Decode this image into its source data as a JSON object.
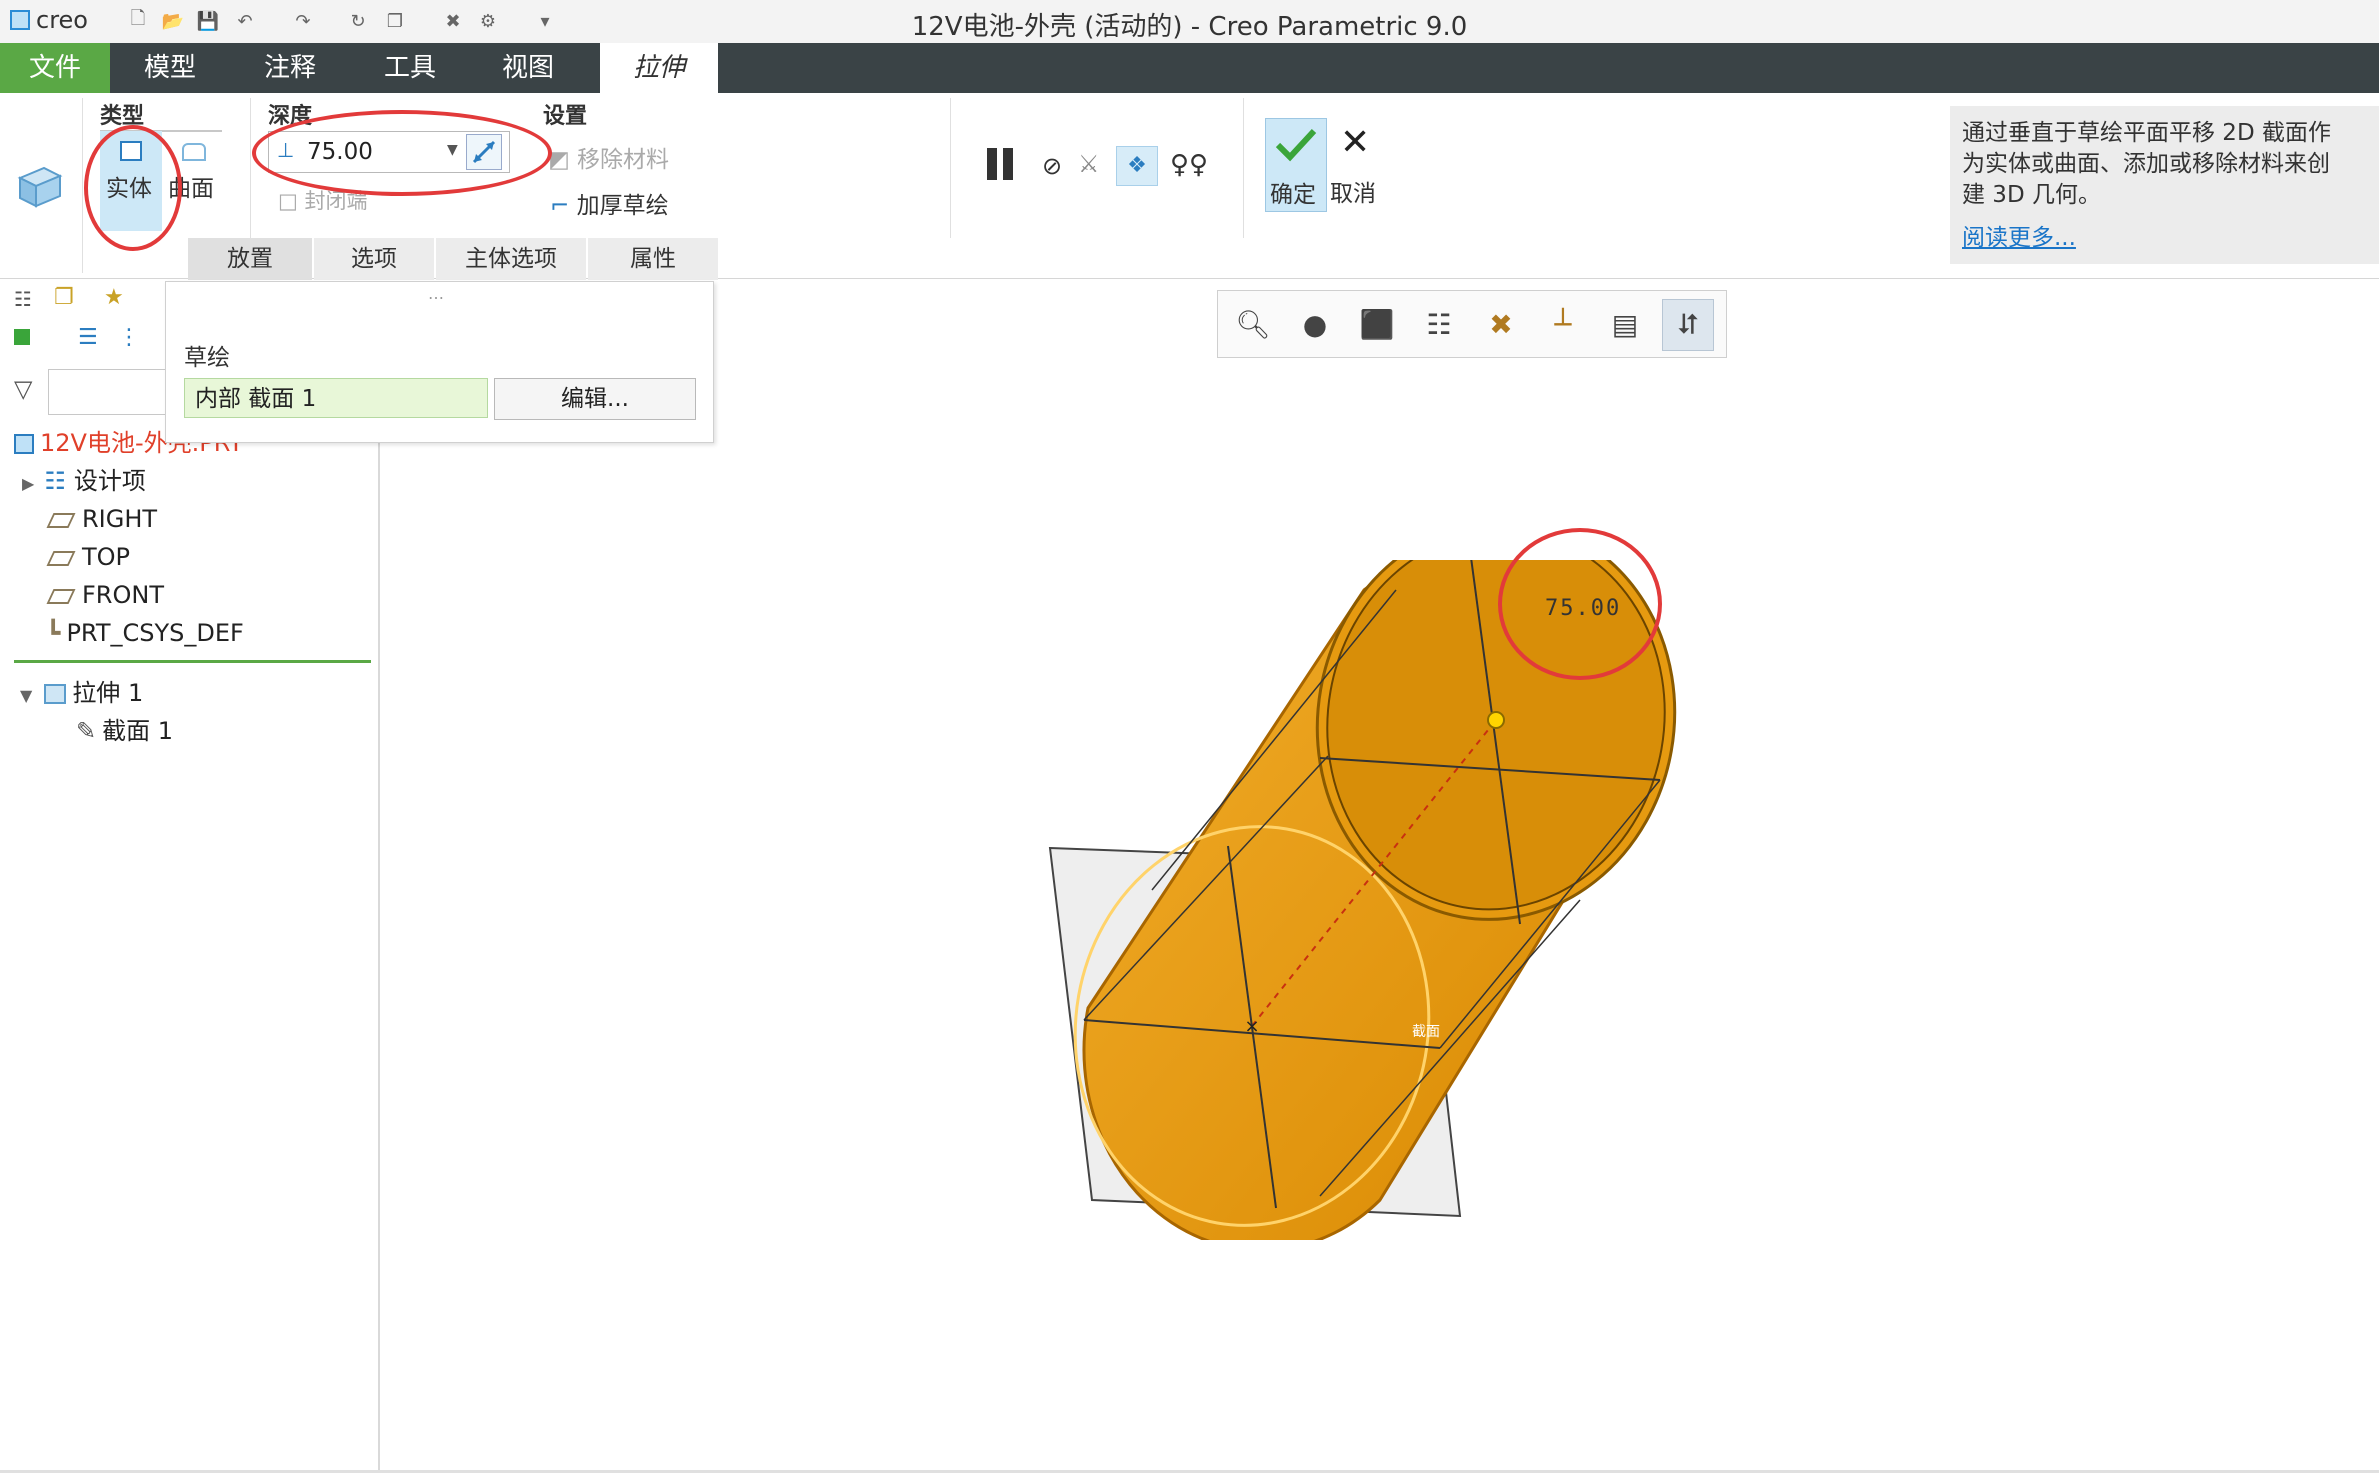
{
  "app": {
    "logo": "creo",
    "window_title": "12V电池-外壳 (活动的) - Creo Parametric 9.0"
  },
  "menu": {
    "tabs": [
      "文件",
      "模型",
      "注释",
      "工具",
      "视图",
      "拉伸"
    ],
    "active": "拉伸",
    "file_color": "#5aa845"
  },
  "ribbon": {
    "type_group": {
      "label": "类型",
      "solid": "实体",
      "surface": "曲面"
    },
    "depth_group": {
      "label": "深度",
      "value": "75.00",
      "cap_ends": "封闭端"
    },
    "settings_group": {
      "label": "设置",
      "remove_material": "移除材料",
      "thicken_sketch": "加厚草绘"
    },
    "actions": {
      "ok": "确定",
      "cancel": "取消"
    },
    "subtabs": [
      "放置",
      "选项",
      "主体选项",
      "属性"
    ],
    "help_text": "通过垂直于草绘平面平移 2D 截面作为实体或曲面、添加或移除材料来创建 3D 几何。",
    "help_link": "阅读更多..."
  },
  "placement_popup": {
    "sketch_label": "草绘",
    "sketch_value": "内部 截面 1",
    "edit_button": "编辑..."
  },
  "model_tree": {
    "root": "12V电池-外壳.PRT",
    "items": [
      "设计项",
      "RIGHT",
      "TOP",
      "FRONT",
      "PRT_CSYS_DEF"
    ],
    "feature": "拉伸 1",
    "sub_feature": "截面 1"
  },
  "graphics": {
    "dimension_label": "75.00",
    "section_label": "截面",
    "cylinder_color": "#f0a010"
  }
}
